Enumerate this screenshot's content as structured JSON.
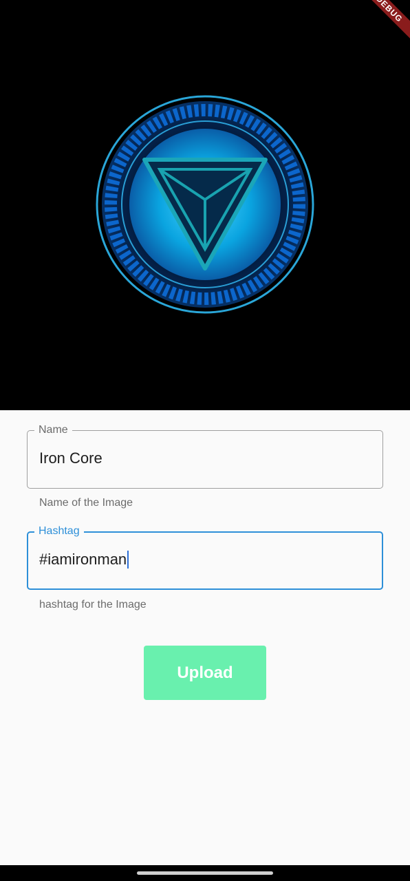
{
  "debug_banner": "DEBUG",
  "image": {
    "subject": "arc-reactor-icon"
  },
  "form": {
    "name": {
      "label": "Name",
      "value": "Iron Core",
      "helper": "Name of the Image"
    },
    "hashtag": {
      "label": "Hashtag",
      "value": "#iamironman",
      "helper": "hashtag for the Image"
    }
  },
  "upload_button": {
    "label": "Upload"
  },
  "colors": {
    "focus_blue": "#2d8fd8",
    "button_green": "#69f0ae",
    "banner_red": "#8a1c1c"
  }
}
